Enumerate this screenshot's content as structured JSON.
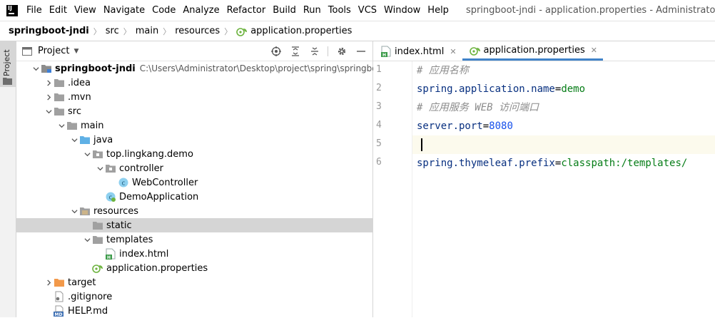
{
  "menu": [
    "File",
    "Edit",
    "View",
    "Navigate",
    "Code",
    "Analyze",
    "Refactor",
    "Build",
    "Run",
    "Tools",
    "VCS",
    "Window",
    "Help"
  ],
  "window_title": "springboot-jndi - application.properties - Administrator",
  "breadcrumb": [
    "springboot-jndi",
    "src",
    "main",
    "resources",
    "application.properties"
  ],
  "stripe_label": "Project",
  "project_panel": {
    "title": "Project"
  },
  "tree": [
    {
      "label": "springboot-jndi",
      "path": "C:\\Users\\Administrator\\Desktop\\project\\spring\\springboot-jndi",
      "icon": "module-folder-icon",
      "depth": 0,
      "chevron": "down",
      "bold": true
    },
    {
      "label": ".idea",
      "icon": "folder-icon",
      "depth": 1,
      "chevron": "right"
    },
    {
      "label": ".mvn",
      "icon": "folder-icon",
      "depth": 1,
      "chevron": "right"
    },
    {
      "label": "src",
      "icon": "folder-icon",
      "depth": 1,
      "chevron": "down"
    },
    {
      "label": "main",
      "icon": "folder-icon",
      "depth": 2,
      "chevron": "down"
    },
    {
      "label": "java",
      "icon": "source-folder-icon",
      "depth": 3,
      "chevron": "down"
    },
    {
      "label": "top.lingkang.demo",
      "icon": "package-icon",
      "depth": 4,
      "chevron": "down"
    },
    {
      "label": "controller",
      "icon": "package-icon",
      "depth": 5,
      "chevron": "down"
    },
    {
      "label": "WebController",
      "icon": "java-class-icon",
      "depth": 6,
      "chevron": "none"
    },
    {
      "label": "DemoApplication",
      "icon": "spring-boot-class-icon",
      "depth": 5,
      "chevron": "none"
    },
    {
      "label": "resources",
      "icon": "resources-folder-icon",
      "depth": 3,
      "chevron": "down"
    },
    {
      "label": "static",
      "icon": "folder-icon",
      "depth": 4,
      "chevron": "none",
      "selected": true
    },
    {
      "label": "templates",
      "icon": "folder-icon",
      "depth": 4,
      "chevron": "down"
    },
    {
      "label": "index.html",
      "icon": "html-file-icon",
      "depth": 5,
      "chevron": "none"
    },
    {
      "label": "application.properties",
      "icon": "properties-file-icon",
      "depth": 4,
      "chevron": "none"
    },
    {
      "label": "target",
      "icon": "excluded-folder-icon",
      "depth": 1,
      "chevron": "right"
    },
    {
      "label": ".gitignore",
      "icon": "gitignore-file-icon",
      "depth": 1,
      "chevron": "none"
    },
    {
      "label": "HELP.md",
      "icon": "markdown-file-icon",
      "depth": 1,
      "chevron": "none"
    }
  ],
  "tabs": [
    {
      "label": "index.html",
      "icon": "html-file-icon",
      "active": false
    },
    {
      "label": "application.properties",
      "icon": "properties-file-icon",
      "active": true
    }
  ],
  "editor_lines": [
    {
      "num": "1",
      "type": "comment",
      "text": "# 应用名称"
    },
    {
      "num": "2",
      "type": "kv",
      "key": "spring.application.name",
      "eq": "=",
      "value": "demo",
      "value_type": "str"
    },
    {
      "num": "3",
      "type": "comment",
      "text": "# 应用服务 WEB 访问端口"
    },
    {
      "num": "4",
      "type": "kv",
      "key": "server.port",
      "eq": "=",
      "value": "8080",
      "value_type": "num"
    },
    {
      "num": "5",
      "type": "empty",
      "current": true
    },
    {
      "num": "6",
      "type": "kv",
      "key": "spring.thymeleaf.prefix",
      "eq": "=",
      "value": "classpath:/templates/",
      "value_type": "str"
    }
  ],
  "colors": {
    "accent": "#4083c9",
    "selection": "#d5d5d5",
    "key": "#083080",
    "string": "#067d17",
    "number": "#1750eb",
    "comment": "#8c8c8c",
    "current_line": "#fcfaed"
  }
}
